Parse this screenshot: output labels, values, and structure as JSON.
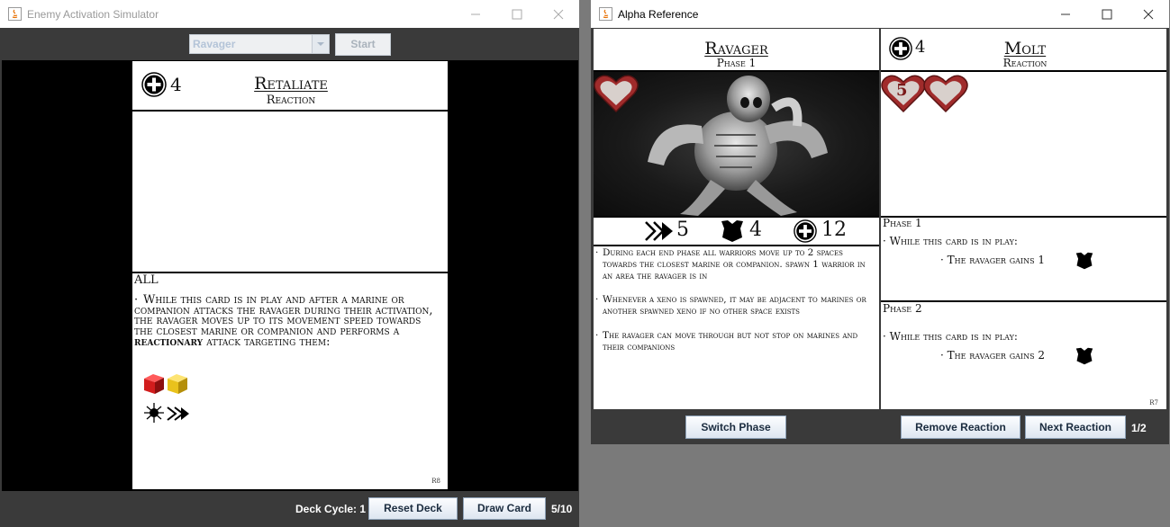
{
  "left_window": {
    "title": "Enemy Activation Simulator",
    "enemy_select": {
      "value": "Ravager"
    },
    "start_label": "Start",
    "card": {
      "cost": "4",
      "title": "Retaliate",
      "subtitle": "Reaction",
      "target_label": "ALL",
      "body_pre": "While this card is in play and after a marine or companion attacks the ravager during their activation, the ravager moves up to its movement speed towards the closest marine or companion and performs a",
      "body_bold": "reactionary",
      "body_post": "attack targeting them:",
      "code": "R8"
    },
    "deck_cycle_label": "Deck Cycle: 1",
    "reset_label": "Reset Deck",
    "draw_label": "Draw Card",
    "count": "5/10",
    "colors": {
      "die_red": "#c81818",
      "die_yellow": "#e8c018"
    }
  },
  "right_window": {
    "title": "Alpha Reference",
    "enemy_card": {
      "name": "Ravager",
      "phase": "Phase 1",
      "stats": {
        "move": "5",
        "armor": "4",
        "health": "12"
      },
      "rules": [
        "During each end phase all warriors move up to 2 spaces towards the closest marine or companion. spawn 1 warrior in an area the ravager is in",
        "Whenever a xeno is spawned, it may be adjacent to marines or another spawned xeno if no other space exists",
        "The ravager can move through but not stop on marines and their companions"
      ]
    },
    "reaction_card": {
      "cost": "4",
      "name": "Molt",
      "subtitle": "Reaction",
      "heart_number": "5",
      "phase1": {
        "label": "Phase 1",
        "line1": "While this card is in play:",
        "line2": "The ravager gains 1"
      },
      "phase2": {
        "label": "Phase 2",
        "line1": "While this card is in play:",
        "line2": "The ravager gains 2"
      },
      "code": "R7"
    },
    "switch_phase_label": "Switch Phase",
    "remove_reaction_label": "Remove Reaction",
    "next_reaction_label": "Next Reaction",
    "page": "1/2"
  }
}
